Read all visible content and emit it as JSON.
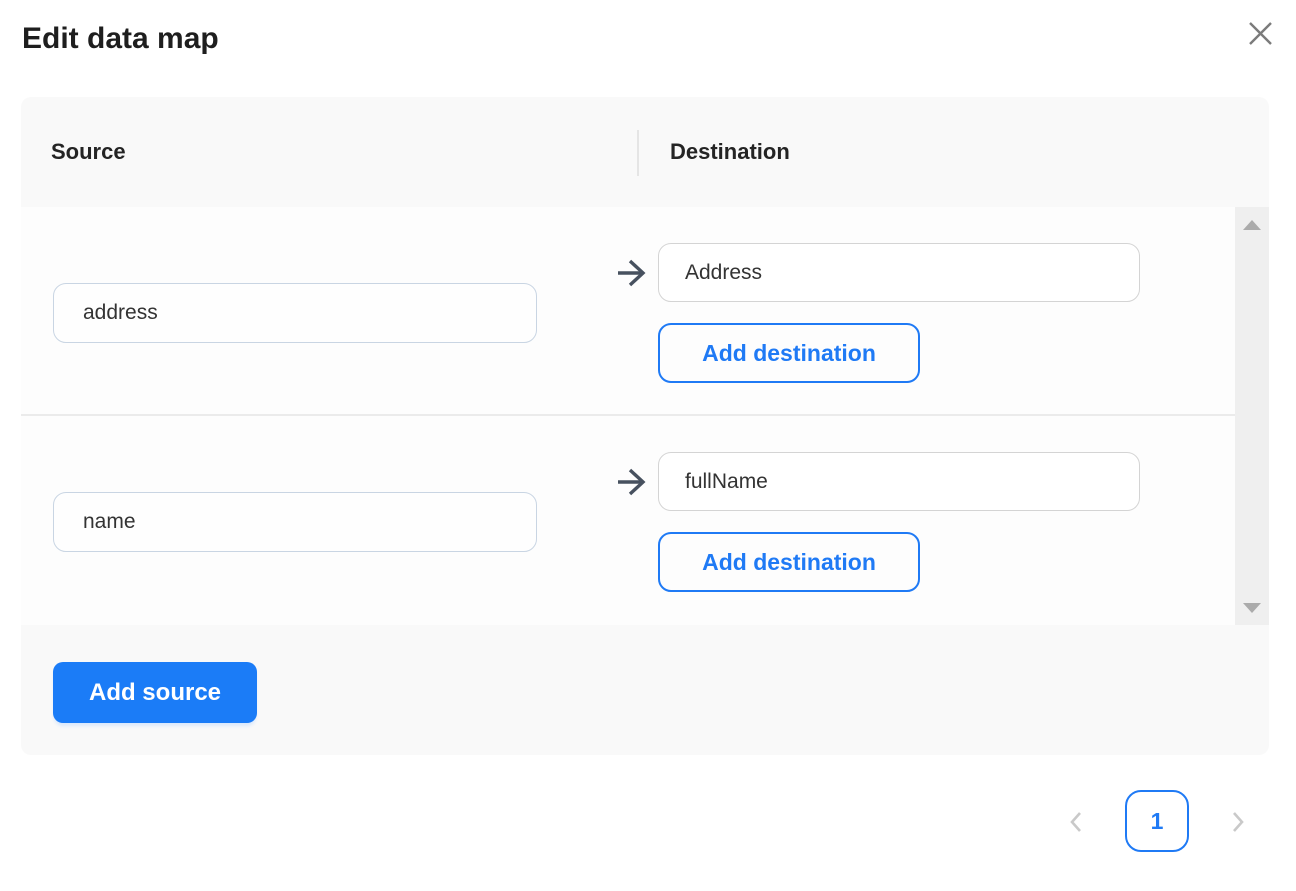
{
  "dialog": {
    "title": "Edit data map"
  },
  "map_table": {
    "source_header": "Source",
    "destination_header": "Destination",
    "rows": [
      {
        "source": "address",
        "destination": "Address",
        "add_destination_label": "Add destination"
      },
      {
        "source": "name",
        "destination": "fullName",
        "add_destination_label": "Add destination"
      }
    ],
    "add_source_label": "Add source"
  },
  "pagination": {
    "current_page": "1"
  },
  "icons": {
    "close": "close-icon",
    "arrow_right": "arrow-right-icon",
    "chevron_left": "chevron-left-icon",
    "chevron_right": "chevron-right-icon",
    "scroll_up": "scroll-up-icon",
    "scroll_down": "scroll-down-icon"
  },
  "colors": {
    "accent_blue": "#1f7af5",
    "accent_blue_fill": "#1b7cf7",
    "arrow_gray": "#47515f",
    "panel_background": "#f9f9f9",
    "row_background": "#fdfdfd",
    "divider": "#ebebeb",
    "scroll_track": "#efefef"
  }
}
